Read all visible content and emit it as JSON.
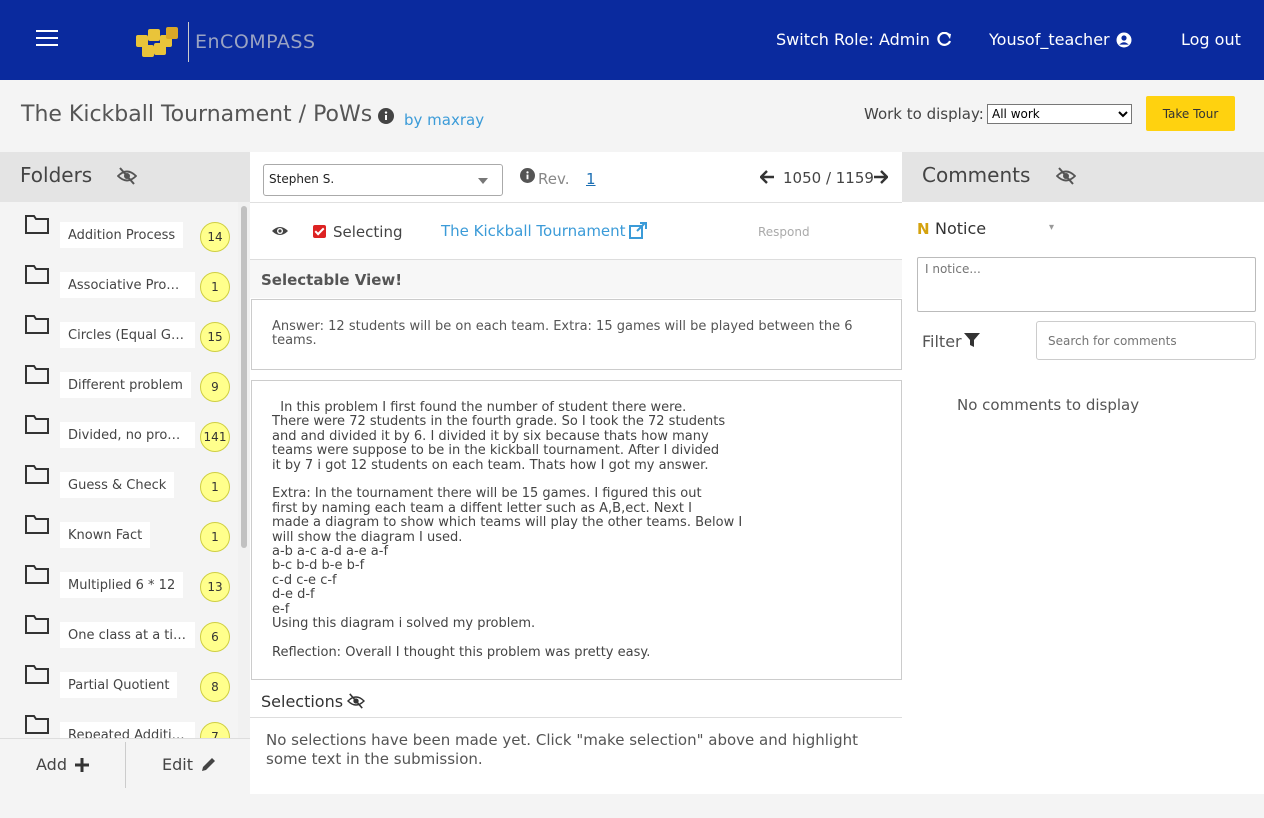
{
  "app": {
    "brand": "EnCOMPASS",
    "accent_color": "#0a2a9e",
    "highlight_color": "#ffd20f"
  },
  "topnav": {
    "switch_role": "Switch Role: Admin",
    "user": "Yousof_teacher",
    "logout": "Log out"
  },
  "workspace": {
    "title": "The Kickball Tournament / PoWs",
    "owner": "by maxray",
    "work_label": "Work to display:",
    "work_selected": "All work",
    "take_tour": "Take Tour"
  },
  "folders": {
    "title": "Folders",
    "items": [
      {
        "label": "Addition Process",
        "count": "14"
      },
      {
        "label": "Associative Property",
        "count": "1"
      },
      {
        "label": "Circles (Equal Grou...",
        "count": "15"
      },
      {
        "label": "Different problem",
        "count": "9"
      },
      {
        "label": "Divided, no process",
        "count": "141"
      },
      {
        "label": "Guess & Check",
        "count": "1"
      },
      {
        "label": "Known Fact",
        "count": "1"
      },
      {
        "label": "Multiplied 6 * 12",
        "count": "13"
      },
      {
        "label": "One class at a time",
        "count": "6"
      },
      {
        "label": "Partial Quotient",
        "count": "8"
      },
      {
        "label": "Repeated Addition",
        "count": "7"
      }
    ],
    "add_label": "Add",
    "edit_label": "Edit"
  },
  "submission": {
    "student": "Stephen S.",
    "rev_label": "Rev.",
    "rev_number": "1",
    "position": "1050 / 1159",
    "selecting_label": "Selecting",
    "problem_link": "The Kickball Tournament",
    "respond_label": "Respond",
    "selectable_title": "Selectable View!",
    "answer": "Answer: 12 students will be on each team. Extra: 15 games will be played between the 6 teams.",
    "explanation": "  In this problem I first found the number of student there were.\nThere were 72 students in the fourth grade. So I took the 72 students\nand and divided it by 6. I divided it by six because thats how many\nteams were suppose to be in the kickball tournament. After I divided\nit by 7 i got 12 students on each team. Thats how I got my answer.\n\nExtra: In the tournament there will be 15 games. I figured this out\nfirst by naming each team a diffent letter such as A,B,ect. Next I\nmade a diagram to show which teams will play the other teams. Below I\nwill show the diagram I used.\na-b a-c a-d a-e a-f\nb-c b-d b-e b-f\nc-d c-e c-f\nd-e d-f\ne-f\nUsing this diagram i solved my problem.\n\nReflection: Overall I thought this problem was pretty easy.",
    "selections_title": "Selections",
    "selections_empty": "No selections have been made yet. Click \"make selection\" above and highlight some text in the submission."
  },
  "comments": {
    "title": "Comments",
    "label_letter": "N",
    "label_type": "Notice",
    "placeholder": "I notice...",
    "filter_label": "Filter",
    "search_placeholder": "Search for comments",
    "empty": "No comments to display"
  }
}
